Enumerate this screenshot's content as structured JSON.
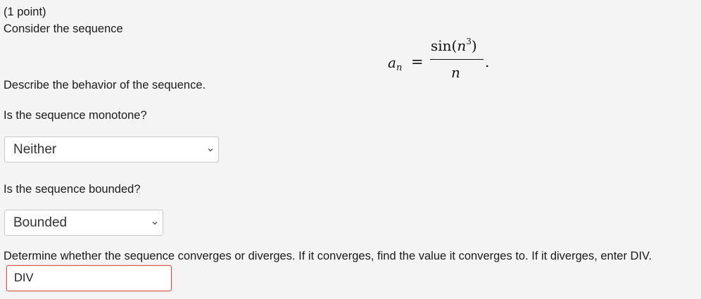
{
  "problem": {
    "points": "(1 point)",
    "intro": "Consider the sequence",
    "formula": {
      "lhs_var": "a",
      "lhs_sub": "n",
      "equals": "=",
      "num_func": "sin(",
      "num_var": "n",
      "num_exp": "3",
      "num_close": ")",
      "den_var": "n",
      "period": "."
    },
    "describe": "Describe the behavior of the sequence."
  },
  "q_monotone": {
    "prompt": "Is the sequence monotone?",
    "selected": "Neither"
  },
  "q_bounded": {
    "prompt": "Is the sequence bounded?",
    "selected": "Bounded"
  },
  "q_converge": {
    "prompt": "Determine whether the sequence converges or diverges. If it converges, find the value it converges to. If it diverges, enter DIV.",
    "answer": "DIV"
  },
  "icons": {
    "dropdown": "chevron-down-icon"
  }
}
